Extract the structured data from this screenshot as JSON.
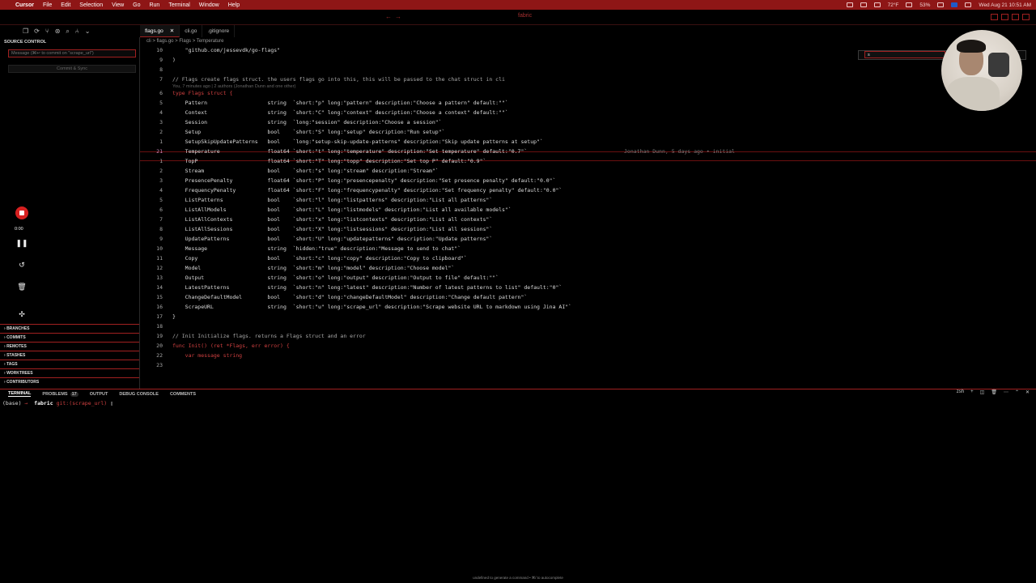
{
  "menubar": {
    "apple": "",
    "app": "Cursor",
    "items": [
      "File",
      "Edit",
      "Selection",
      "View",
      "Go",
      "Run",
      "Terminal",
      "Window",
      "Help"
    ],
    "temperature": "72°F",
    "battery": "53%",
    "datetime": "Wed Aug 21  10:51 AM"
  },
  "titlebar": {
    "title": "fabric"
  },
  "tabs": [
    {
      "label": "flags.go",
      "active": true
    },
    {
      "label": "cli.go",
      "active": false
    },
    {
      "label": ".gitignore",
      "active": false
    }
  ],
  "breadcrumb": "cli > flags.go > Flags > Temperature",
  "sidebar": {
    "title": "SOURCE CONTROL",
    "commit_placeholder": "Message (⌘↩ to commit on \"scrape_url\")",
    "commit_button": "Commit & Sync",
    "rec_time": "0:00",
    "sections": [
      "BRANCHES",
      "COMMITS",
      "REMOTES",
      "STASHES",
      "TAGS",
      "WORKTREES",
      "CONTRIBUTORS"
    ]
  },
  "editor": {
    "codelens": "You, 7 minutes ago | 2 authors (Jonathan Dunn and one other)",
    "blame": "Jonathan Dunn, 5 days ago • initial",
    "lines": [
      {
        "n": "10",
        "t": "    \"github.com/jessevdk/go-flags\""
      },
      {
        "n": "9",
        "t": ")"
      },
      {
        "n": "8",
        "t": ""
      },
      {
        "n": "7",
        "t": "// Flags create flags struct. the users flags go into this, this will be passed to the chat struct in cli"
      },
      {
        "n": "6",
        "t": "type Flags struct {"
      },
      {
        "n": "5",
        "t": "    Pattern                   string  `short:\"p\" long:\"pattern\" description:\"Choose a pattern\" default:\"\"`"
      },
      {
        "n": "4",
        "t": "    Context                   string  `short:\"C\" long:\"context\" description:\"Choose a context\" default:\"\"`"
      },
      {
        "n": "3",
        "t": "    Session                   string  `long:\"session\" description:\"Choose a session\"`"
      },
      {
        "n": "2",
        "t": "    Setup                     bool    `short:\"S\" long:\"setup\" description:\"Run setup\"`"
      },
      {
        "n": "1",
        "t": "    SetupSkipUpdatePatterns   bool    `long:\"setup-skip-update-patterns\" description:\"Skip update patterns at setup\"`"
      },
      {
        "n": "21",
        "t": "    Temperature               float64 `short:\"t\" long:\"temperature\" description:\"Set temperature\" default:\"0.7\"`"
      },
      {
        "n": "1",
        "t": "    TopP                      float64 `short:\"T\" long:\"topp\" description:\"Set top P\" default:\"0.9\"`"
      },
      {
        "n": "2",
        "t": "    Stream                    bool    `short:\"s\" long:\"stream\" description:\"Stream\"`"
      },
      {
        "n": "3",
        "t": "    PresencePenalty           float64 `short:\"P\" long:\"presencepenalty\" description:\"Set presence penalty\" default:\"0.0\"`"
      },
      {
        "n": "4",
        "t": "    FrequencyPenalty          float64 `short:\"F\" long:\"frequencypenalty\" description:\"Set frequency penalty\" default:\"0.0\"`"
      },
      {
        "n": "5",
        "t": "    ListPatterns              bool    `short:\"l\" long:\"listpatterns\" description:\"List all patterns\"`"
      },
      {
        "n": "6",
        "t": "    ListAllModels             bool    `short:\"L\" long:\"listmodels\" description:\"List all available models\"`"
      },
      {
        "n": "7",
        "t": "    ListAllContexts           bool    `short:\"x\" long:\"listcontexts\" description:\"List all contexts\"`"
      },
      {
        "n": "8",
        "t": "    ListAllSessions           bool    `short:\"X\" long:\"listsessions\" description:\"List all sessions\"`"
      },
      {
        "n": "9",
        "t": "    UpdatePatterns            bool    `short:\"U\" long:\"updatepatterns\" description:\"Update patterns\"`"
      },
      {
        "n": "10",
        "t": "    Message                   string  `hidden:\"true\" description:\"Message to send to chat\"`"
      },
      {
        "n": "11",
        "t": "    Copy                      bool    `short:\"c\" long:\"copy\" description:\"Copy to clipboard\"`"
      },
      {
        "n": "12",
        "t": "    Model                     string  `short:\"m\" long:\"model\" description:\"Choose model\"`"
      },
      {
        "n": "13",
        "t": "    Output                    string  `short:\"o\" long:\"output\" description:\"Output to file\" default:\"\"`"
      },
      {
        "n": "14",
        "t": "    LatestPatterns            string  `short:\"n\" long:\"latest\" description:\"Number of latest patterns to list\" default:\"0\"`"
      },
      {
        "n": "15",
        "t": "    ChangeDefaultModel        bool    `short:\"d\" long:\"changeDefaultModel\" description:\"Change default pattern\"`"
      },
      {
        "n": "16",
        "t": "    ScrapeURL                 string  `short:\"u\" long:\"scrape_url\" description:\"Scrape website URL to markdown using Jina AI\"`"
      },
      {
        "n": "17",
        "t": "}"
      },
      {
        "n": "18",
        "t": ""
      },
      {
        "n": "19",
        "t": "// Init Initialize flags. returns a Flags struct and an error"
      },
      {
        "n": "20",
        "t": "func Init() (ret *Flags, err error) {"
      },
      {
        "n": "22",
        "t": "    var message string"
      },
      {
        "n": "23",
        "t": ""
      }
    ]
  },
  "find": {
    "value": "s"
  },
  "panel": {
    "tabs": [
      "TERMINAL",
      "PROBLEMS",
      "OUTPUT",
      "DEBUG CONSOLE",
      "COMMENTS"
    ],
    "problems_count": "17",
    "shell": "zsh"
  },
  "terminal": {
    "env": "(base)",
    "arrow": "→",
    "dir": "fabric",
    "branch_label": "git:(scrape_url)",
    "cursor": "▯"
  },
  "statusbar": {
    "hint": "undefined to generate a command • ⌘/ to autocomplete"
  }
}
